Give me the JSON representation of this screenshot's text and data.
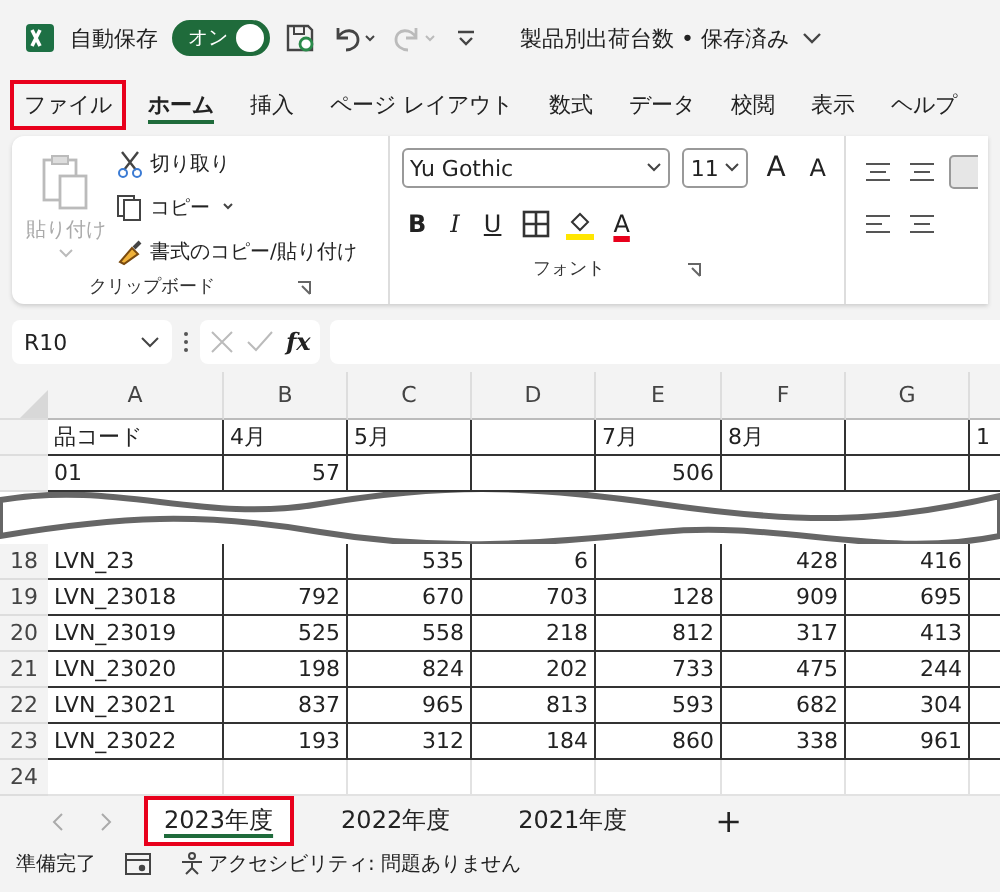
{
  "title_bar": {
    "autosave_label": "自動保存",
    "autosave": {
      "label": "オン",
      "on": true
    },
    "document_title": "製品別出荷台数 • 保存済み"
  },
  "ribbon_tabs": [
    {
      "label": "ファイル",
      "selected": false,
      "highlighted": true
    },
    {
      "label": "ホーム",
      "selected": true,
      "highlighted": false
    },
    {
      "label": "挿入",
      "selected": false,
      "highlighted": false
    },
    {
      "label": "ページ レイアウト",
      "selected": false,
      "highlighted": false
    },
    {
      "label": "数式",
      "selected": false,
      "highlighted": false
    },
    {
      "label": "データ",
      "selected": false,
      "highlighted": false
    },
    {
      "label": "校閲",
      "selected": false,
      "highlighted": false
    },
    {
      "label": "表示",
      "selected": false,
      "highlighted": false
    },
    {
      "label": "ヘルプ",
      "selected": false,
      "highlighted": false
    }
  ],
  "clipboard": {
    "paste": {
      "label": "貼り付け",
      "disabled": true
    },
    "cut": "切り取り",
    "copy": "コピー",
    "format_painter": "書式のコピー/貼り付け",
    "group_label": "クリップボード"
  },
  "font": {
    "font_name": "Yu Gothic",
    "font_size": "11",
    "grow": "A",
    "shrink": "A",
    "bold": "B",
    "italic": "I",
    "underline": "U",
    "font_color": "A",
    "group_label": "フォント"
  },
  "formula_bar": {
    "name_box": "R10",
    "function_label": "fx"
  },
  "grid": {
    "columns": [
      "A",
      "B",
      "C",
      "D",
      "E",
      "F",
      "G"
    ],
    "rows": [
      {
        "kind": "header",
        "cells": [
          "品コード",
          "4月",
          "5月",
          null,
          "7月",
          "8月",
          null,
          "1"
        ]
      },
      {
        "kind": "data",
        "cells": [
          "01",
          "57",
          null,
          null,
          "506",
          null,
          null,
          null
        ]
      },
      {
        "kind": "break"
      },
      {
        "kind": "data",
        "number": "18",
        "cells": [
          "LVN_23",
          null,
          "535",
          "6",
          null,
          "428",
          "416",
          null
        ]
      },
      {
        "kind": "data",
        "number": "19",
        "cells": [
          "LVN_23018",
          "792",
          "670",
          "703",
          "128",
          "909",
          "695",
          null
        ]
      },
      {
        "kind": "data",
        "number": "20",
        "cells": [
          "LVN_23019",
          "525",
          "558",
          "218",
          "812",
          "317",
          "413",
          null
        ]
      },
      {
        "kind": "data",
        "number": "21",
        "cells": [
          "LVN_23020",
          "198",
          "824",
          "202",
          "733",
          "475",
          "244",
          null
        ]
      },
      {
        "kind": "data",
        "number": "22",
        "cells": [
          "LVN_23021",
          "837",
          "965",
          "813",
          "593",
          "682",
          "304",
          null
        ]
      },
      {
        "kind": "data",
        "number": "23",
        "cells": [
          "LVN_23022",
          "193",
          "312",
          "184",
          "860",
          "338",
          "961",
          null
        ]
      },
      {
        "kind": "empty",
        "number": "24"
      }
    ]
  },
  "sheet_tabs": [
    {
      "label": "2023年度",
      "selected": true,
      "highlighted": true
    },
    {
      "label": "2022年度",
      "selected": false,
      "highlighted": false
    },
    {
      "label": "2021年度",
      "selected": false,
      "highlighted": false
    }
  ],
  "add_sheet": "+",
  "status_bar": {
    "ready": "準備完了",
    "accessibility": "アクセシビリティ: 問題ありません"
  }
}
